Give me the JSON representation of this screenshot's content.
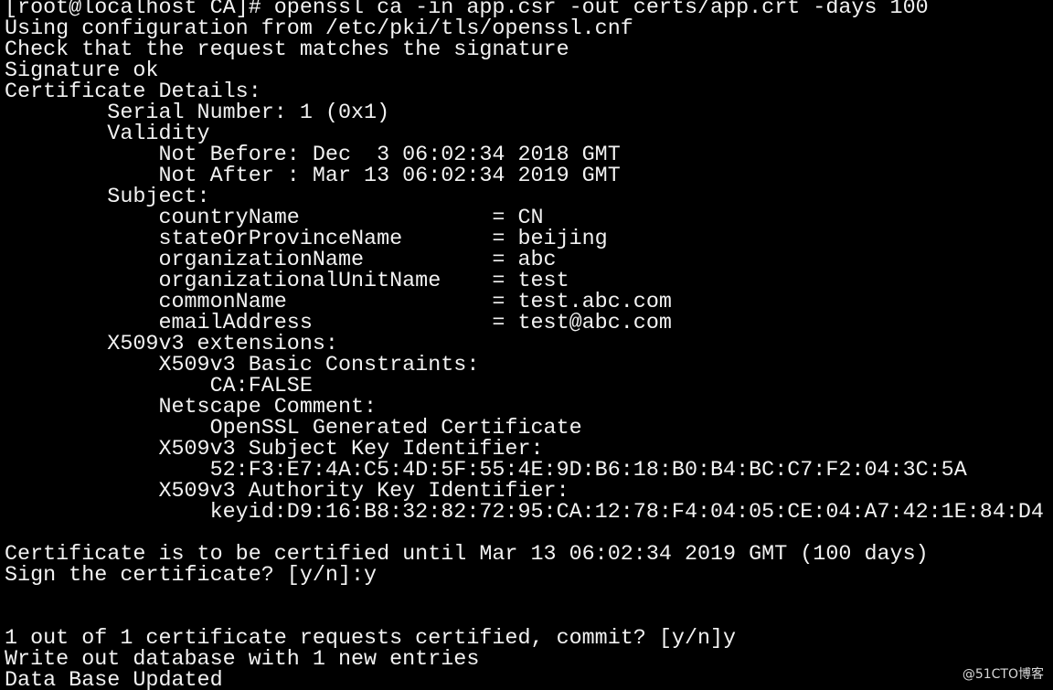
{
  "terminal": {
    "background": "#000000",
    "foreground": "#f2f2f2",
    "lines": [
      "[root@localhost CA]# openssl ca -in app.csr -out certs/app.crt -days 100",
      "Using configuration from /etc/pki/tls/openssl.cnf",
      "Check that the request matches the signature",
      "Signature ok",
      "Certificate Details:",
      "        Serial Number: 1 (0x1)",
      "        Validity",
      "            Not Before: Dec  3 06:02:34 2018 GMT",
      "            Not After : Mar 13 06:02:34 2019 GMT",
      "        Subject:",
      "            countryName               = CN",
      "            stateOrProvinceName       = beijing",
      "            organizationName          = abc",
      "            organizationalUnitName    = test",
      "            commonName                = test.abc.com",
      "            emailAddress              = test@abc.com",
      "        X509v3 extensions:",
      "            X509v3 Basic Constraints:",
      "                CA:FALSE",
      "            Netscape Comment:",
      "                OpenSSL Generated Certificate",
      "            X509v3 Subject Key Identifier:",
      "                52:F3:E7:4A:C5:4D:5F:55:4E:9D:B6:18:B0:B4:BC:C7:F2:04:3C:5A",
      "            X509v3 Authority Key Identifier:",
      "                keyid:D9:16:B8:32:82:72:95:CA:12:78:F4:04:05:CE:04:A7:42:1E:84:D4",
      "",
      "Certificate is to be certified until Mar 13 06:02:34 2019 GMT (100 days)",
      "Sign the certificate? [y/n]:y",
      "",
      "",
      "1 out of 1 certificate requests certified, commit? [y/n]y",
      "Write out database with 1 new entries",
      "Data Base Updated"
    ],
    "watermark": "@51CTO博客"
  }
}
